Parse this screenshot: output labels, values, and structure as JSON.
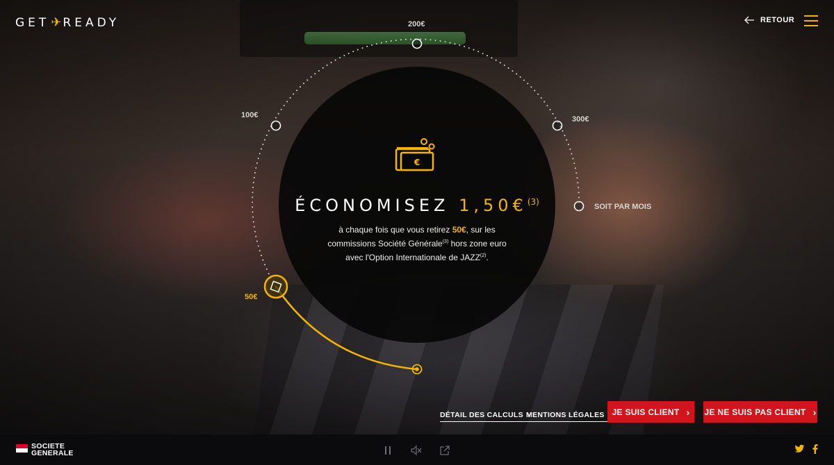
{
  "header": {
    "logo_left": "GET",
    "logo_right": "READY",
    "back_label": "RETOUR"
  },
  "dial": {
    "labels": {
      "v50": "50€",
      "v100": "100€",
      "v200": "200€",
      "v300": "300€",
      "monthly": "SOIT PAR MOIS"
    },
    "selected": "50€"
  },
  "main": {
    "headline_prefix": "ÉCONOMISEZ",
    "headline_amount": "1,50€",
    "headline_note": "(3)",
    "body": {
      "part1": "à chaque fois que vous retirez ",
      "amount": "50€",
      "part2": ", sur les commissions Société Générale",
      "note1": "(3)",
      "part3": " hors zone euro avec l'Option Internationale de JAZZ",
      "note2": "(2)",
      "part4": "."
    }
  },
  "actions": {
    "detail_link": "DÉTAIL DES CALCULS",
    "legal_link": "MENTIONS LÉGALES",
    "client_button": "JE SUIS CLIENT",
    "not_client_button": "JE NE SUIS PAS CLIENT"
  },
  "footer": {
    "brand_line1": "SOCIETE",
    "brand_line2": "GENERALE",
    "controls": [
      "pause-icon",
      "mute-icon",
      "share-icon"
    ],
    "social": [
      "twitter-icon",
      "facebook-icon"
    ]
  },
  "colors": {
    "accent": "#f5b400",
    "button": "#d2151c",
    "footer": "#0b0b0e"
  }
}
